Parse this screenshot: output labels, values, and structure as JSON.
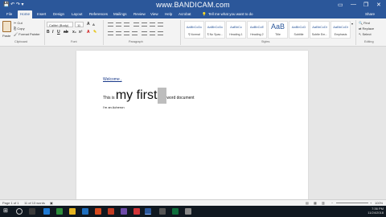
{
  "window": {
    "watermark": "www.BANDICAM.com",
    "min_glyph": "—",
    "max_glyph": "❐",
    "close_glyph": "✕"
  },
  "menu": {
    "tabs": [
      "File",
      "Home",
      "Insert",
      "Design",
      "Layout",
      "References",
      "Mailings",
      "Review",
      "View",
      "Help",
      "Acrobat"
    ],
    "tell_me": "Tell me what you want to do",
    "share": "Share"
  },
  "ribbon": {
    "clipboard": {
      "paste": "Paste",
      "cut": "Cut",
      "copy": "Copy",
      "format_painter": "Format Painter",
      "label": "Clipboard"
    },
    "font": {
      "name": "Calibri (Body)",
      "size": "11",
      "label": "Font"
    },
    "paragraph_label": "Paragraph",
    "styles": {
      "label": "Styles",
      "cards": [
        {
          "preview": "AaBbCcDc",
          "name": "¶ Normal"
        },
        {
          "preview": "AaBbCcDc",
          "name": "¶ No Spac..."
        },
        {
          "preview": "AaBbCc",
          "name": "Heading 1"
        },
        {
          "preview": "AaBbCcE",
          "name": "Heading 2"
        },
        {
          "preview": "AaB",
          "name": "Title"
        },
        {
          "preview": "AaBbCcD",
          "name": "Subtitle"
        },
        {
          "preview": "AaBbCcDi",
          "name": "Subtle Em..."
        },
        {
          "preview": "AaBbCcDi",
          "name": "Emphasis"
        }
      ]
    },
    "editing": {
      "find": "Find",
      "replace": "Replace",
      "select": "Select",
      "label": "Editing"
    }
  },
  "document": {
    "line1": "Welcome ,",
    "line2_pre": "This is",
    "line2_big": "my first",
    "line2_post": "word document",
    "line3": "I'm an Acheron"
  },
  "status": {
    "page": "Page 1 of 1",
    "words": "11 of 13 words",
    "zoom": "100%"
  },
  "taskbar": {
    "time": "7:36 PM",
    "date": "11/24/2018"
  }
}
